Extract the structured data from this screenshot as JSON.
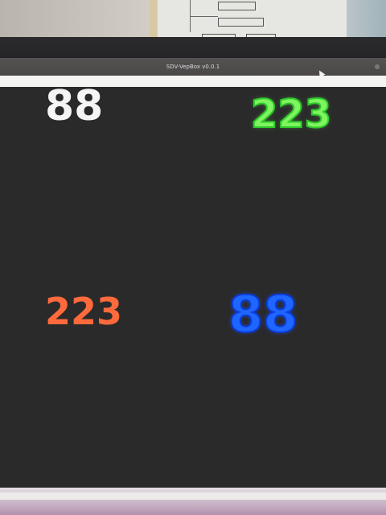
{
  "window": {
    "title": "SDV-VepBox v0.0.1"
  },
  "display": {
    "top_left_value": "88",
    "top_right_value": "223",
    "bottom_left_value": "223",
    "bottom_right_value": "88"
  },
  "colors": {
    "background": "#2b2a2b",
    "white_number": "#f5f5f5",
    "green_number": "#7ef55f",
    "orange_number": "#ff6a3d",
    "blue_number": "#1e66ff"
  }
}
